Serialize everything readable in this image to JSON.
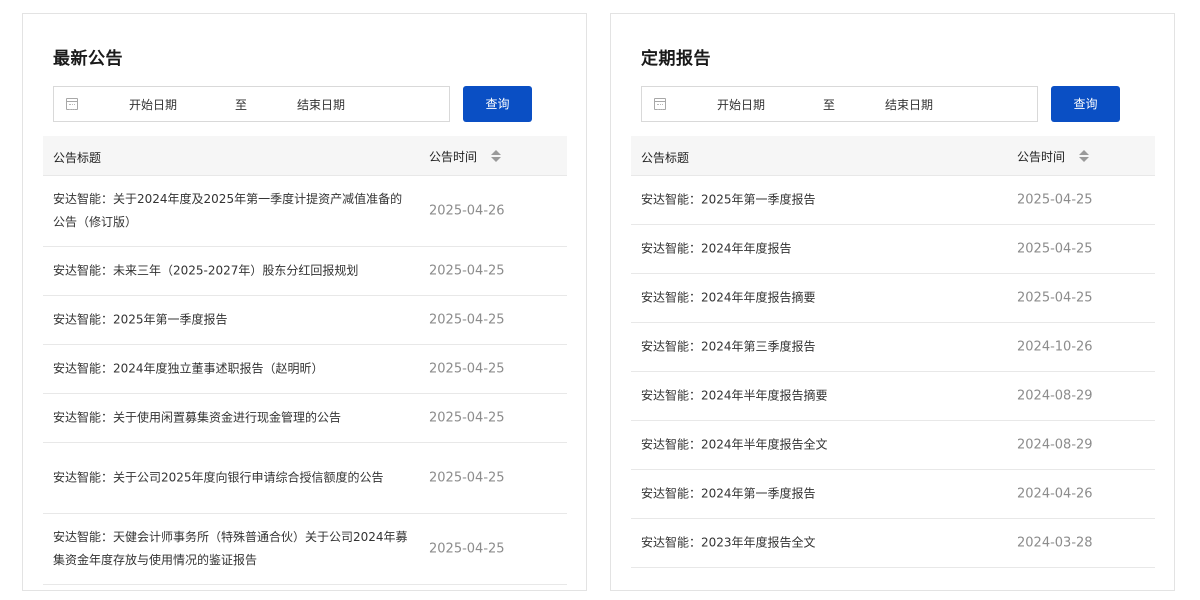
{
  "left_panel": {
    "title": "最新公告",
    "date_start_placeholder": "开始日期",
    "date_separator": "至",
    "date_end_placeholder": "结束日期",
    "query_label": "查询",
    "col_title": "公告标题",
    "col_time": "公告时间",
    "rows": [
      {
        "title": "安达智能：关于2024年度及2025年第一季度计提资产减值准备的公告（修订版）",
        "date": "2025-04-26"
      },
      {
        "title": "安达智能：未来三年（2025-2027年）股东分红回报规划",
        "date": "2025-04-25"
      },
      {
        "title": "安达智能：2025年第一季度报告",
        "date": "2025-04-25"
      },
      {
        "title": "安达智能：2024年度独立董事述职报告（赵明昕）",
        "date": "2025-04-25"
      },
      {
        "title": "安达智能：关于使用闲置募集资金进行现金管理的公告",
        "date": "2025-04-25"
      },
      {
        "title": "安达智能：关于公司2025年度向银行申请综合授信额度的公告",
        "date": "2025-04-25"
      },
      {
        "title": "安达智能：天健会计师事务所（特殊普通合伙）关于公司2024年募集资金年度存放与使用情况的鉴证报告",
        "date": "2025-04-25"
      }
    ]
  },
  "right_panel": {
    "title": "定期报告",
    "date_start_placeholder": "开始日期",
    "date_separator": "至",
    "date_end_placeholder": "结束日期",
    "query_label": "查询",
    "col_title": "公告标题",
    "col_time": "公告时间",
    "rows": [
      {
        "title": "安达智能：2025年第一季度报告",
        "date": "2025-04-25"
      },
      {
        "title": "安达智能：2024年年度报告",
        "date": "2025-04-25"
      },
      {
        "title": "安达智能：2024年年度报告摘要",
        "date": "2025-04-25"
      },
      {
        "title": "安达智能：2024年第三季度报告",
        "date": "2024-10-26"
      },
      {
        "title": "安达智能：2024年半年度报告摘要",
        "date": "2024-08-29"
      },
      {
        "title": "安达智能：2024年半年度报告全文",
        "date": "2024-08-29"
      },
      {
        "title": "安达智能：2024年第一季度报告",
        "date": "2024-04-26"
      },
      {
        "title": "安达智能：2023年年度报告全文",
        "date": "2024-03-28"
      }
    ]
  }
}
